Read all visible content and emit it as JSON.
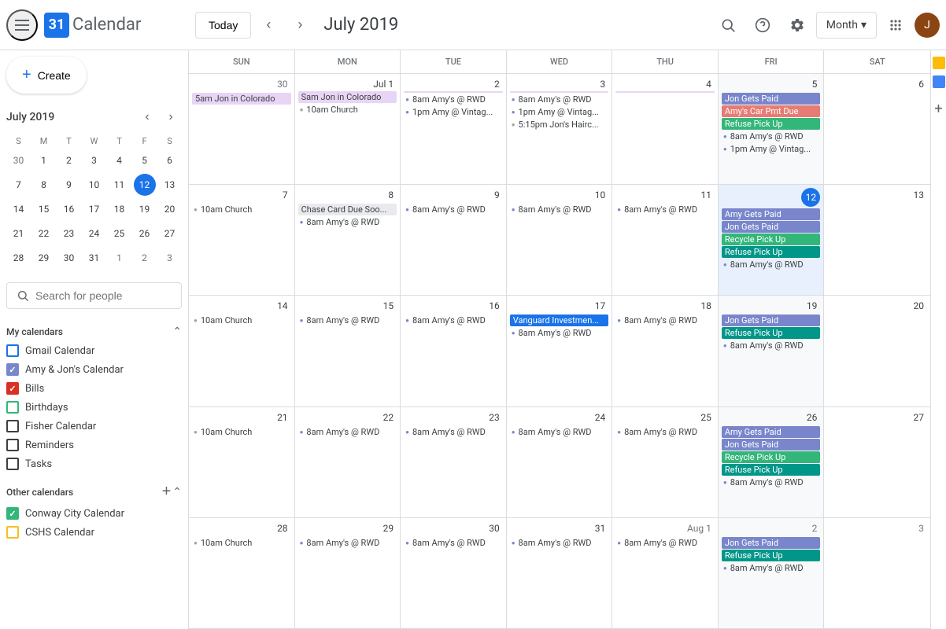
{
  "header": {
    "menu_label": "☰",
    "logo_number": "31",
    "app_title": "Calendar",
    "today_btn": "Today",
    "month_title": "July 2019",
    "view_label": "Month",
    "view_arrow": "▾"
  },
  "sidebar": {
    "create_label": "Create",
    "mini_cal": {
      "title": "July 2019",
      "day_labels": [
        "S",
        "M",
        "T",
        "W",
        "T",
        "F",
        "S"
      ],
      "weeks": [
        [
          {
            "d": "30",
            "other": true
          },
          {
            "d": "1"
          },
          {
            "d": "2"
          },
          {
            "d": "3"
          },
          {
            "d": "4"
          },
          {
            "d": "5"
          },
          {
            "d": "6"
          }
        ],
        [
          {
            "d": "7"
          },
          {
            "d": "8"
          },
          {
            "d": "9"
          },
          {
            "d": "10"
          },
          {
            "d": "11"
          },
          {
            "d": "12",
            "today": true
          },
          {
            "d": "13"
          }
        ],
        [
          {
            "d": "14"
          },
          {
            "d": "15"
          },
          {
            "d": "16"
          },
          {
            "d": "17"
          },
          {
            "d": "18"
          },
          {
            "d": "19"
          },
          {
            "d": "20"
          }
        ],
        [
          {
            "d": "21"
          },
          {
            "d": "22"
          },
          {
            "d": "23"
          },
          {
            "d": "24"
          },
          {
            "d": "25"
          },
          {
            "d": "26"
          },
          {
            "d": "27"
          }
        ],
        [
          {
            "d": "28"
          },
          {
            "d": "29"
          },
          {
            "d": "30"
          },
          {
            "d": "31"
          },
          {
            "d": "1",
            "other": true
          },
          {
            "d": "2",
            "other": true
          },
          {
            "d": "3",
            "other": true
          }
        ]
      ]
    },
    "search_people_placeholder": "Search for people",
    "my_calendars_title": "My calendars",
    "my_calendars": [
      {
        "label": "Gmail Calendar",
        "color": "#1a73e8",
        "checked": false
      },
      {
        "label": "Amy & Jon's Calendar",
        "color": "#7986cb",
        "checked": true
      },
      {
        "label": "Bills",
        "color": "#d93025",
        "checked": true
      },
      {
        "label": "Birthdays",
        "color": "#33b679",
        "checked": false
      },
      {
        "label": "Fisher Calendar",
        "color": "#3c4043",
        "checked": false
      },
      {
        "label": "Reminders",
        "color": "#3c4043",
        "checked": false
      },
      {
        "label": "Tasks",
        "color": "#3c4043",
        "checked": false
      }
    ],
    "other_calendars_title": "Other calendars",
    "other_calendars": [
      {
        "label": "Conway City Calendar",
        "color": "#33b679",
        "checked": true
      },
      {
        "label": "CSHS Calendar",
        "color": "#f6bf26",
        "checked": false
      }
    ]
  },
  "calendar": {
    "day_headers": [
      "SUN",
      "MON",
      "TUE",
      "WED",
      "THU",
      "FRI",
      "SAT"
    ],
    "weeks": [
      {
        "days": [
          {
            "date": "30",
            "other": true,
            "events": [
              {
                "type": "multiday",
                "label": "5am Jon in Colorado",
                "color": "lavender"
              }
            ]
          },
          {
            "date": "Jul 1",
            "events": [
              {
                "type": "gray-dot",
                "label": "10am Church"
              }
            ]
          },
          {
            "date": "2",
            "events": [
              {
                "type": "purple-dot",
                "label": "8am Amy's @ RWD"
              },
              {
                "type": "purple-dot",
                "label": "1pm Amy @ Vintag..."
              }
            ]
          },
          {
            "date": "3",
            "events": [
              {
                "type": "purple-dot",
                "label": "8am Amy's @ RWD"
              },
              {
                "type": "purple-dot",
                "label": "1pm Amy @ Vintag..."
              },
              {
                "type": "gray-dot",
                "label": "5:15pm Jon's Hairc..."
              }
            ]
          },
          {
            "date": "4",
            "events": []
          },
          {
            "date": "5",
            "fri": true,
            "events": [
              {
                "type": "purple-bg",
                "label": "Jon Gets Paid"
              },
              {
                "type": "pink-bg",
                "label": "Amy's Car Pmt Due"
              },
              {
                "type": "green-bg",
                "label": "Refuse Pick Up"
              },
              {
                "type": "purple-dot",
                "label": "8am Amy's @ RWD"
              },
              {
                "type": "purple-dot",
                "label": "1pm Amy @ Vintag..."
              }
            ]
          },
          {
            "date": "6",
            "events": []
          }
        ]
      },
      {
        "days": [
          {
            "date": "7",
            "events": [
              {
                "type": "gray-dot",
                "label": "10am Church"
              }
            ]
          },
          {
            "date": "8",
            "events": [
              {
                "type": "lavender-bg",
                "label": "Chase Card Due Soo..."
              },
              {
                "type": "purple-dot",
                "label": "8am Amy's @ RWD"
              }
            ]
          },
          {
            "date": "9",
            "events": [
              {
                "type": "purple-dot",
                "label": "8am Amy's @ RWD"
              }
            ]
          },
          {
            "date": "10",
            "events": [
              {
                "type": "purple-dot",
                "label": "8am Amy's @ RWD"
              }
            ]
          },
          {
            "date": "11",
            "events": [
              {
                "type": "purple-dot",
                "label": "8am Amy's @ RWD"
              }
            ]
          },
          {
            "date": "12",
            "today": true,
            "fri": true,
            "events": [
              {
                "type": "purple-bg",
                "label": "Amy Gets Paid"
              },
              {
                "type": "purple-bg",
                "label": "Jon Gets Paid"
              },
              {
                "type": "green-bg",
                "label": "Recycle Pick Up"
              },
              {
                "type": "teal-bg",
                "label": "Refuse Pick Up"
              },
              {
                "type": "purple-dot",
                "label": "8am Amy's @ RWD"
              }
            ]
          },
          {
            "date": "13",
            "events": []
          }
        ]
      },
      {
        "days": [
          {
            "date": "14",
            "events": [
              {
                "type": "gray-dot",
                "label": "10am Church"
              }
            ]
          },
          {
            "date": "15",
            "events": [
              {
                "type": "purple-dot",
                "label": "8am Amy's @ RWD"
              }
            ]
          },
          {
            "date": "16",
            "events": [
              {
                "type": "purple-dot",
                "label": "8am Amy's @ RWD"
              }
            ]
          },
          {
            "date": "17",
            "events": [
              {
                "type": "blue-bg",
                "label": "Vanguard Investmen..."
              },
              {
                "type": "purple-dot",
                "label": "8am Amy's @ RWD"
              }
            ]
          },
          {
            "date": "18",
            "events": [
              {
                "type": "purple-dot",
                "label": "8am Amy's @ RWD"
              }
            ]
          },
          {
            "date": "19",
            "fri": true,
            "events": [
              {
                "type": "purple-bg",
                "label": "Jon Gets Paid"
              },
              {
                "type": "teal-bg",
                "label": "Refuse Pick Up"
              },
              {
                "type": "purple-dot",
                "label": "8am Amy's @ RWD"
              }
            ]
          },
          {
            "date": "20",
            "events": []
          }
        ]
      },
      {
        "days": [
          {
            "date": "21",
            "events": [
              {
                "type": "gray-dot",
                "label": "10am Church"
              }
            ]
          },
          {
            "date": "22",
            "events": [
              {
                "type": "purple-dot",
                "label": "8am Amy's @ RWD"
              }
            ]
          },
          {
            "date": "23",
            "events": [
              {
                "type": "purple-dot",
                "label": "8am Amy's @ RWD"
              }
            ]
          },
          {
            "date": "24",
            "events": [
              {
                "type": "purple-dot",
                "label": "8am Amy's @ RWD"
              }
            ]
          },
          {
            "date": "25",
            "events": [
              {
                "type": "purple-dot",
                "label": "8am Amy's @ RWD"
              }
            ]
          },
          {
            "date": "26",
            "fri": true,
            "events": [
              {
                "type": "purple-bg",
                "label": "Amy Gets Paid"
              },
              {
                "type": "purple-bg",
                "label": "Jon Gets Paid"
              },
              {
                "type": "green-bg",
                "label": "Recycle Pick Up"
              },
              {
                "type": "teal-bg",
                "label": "Refuse Pick Up"
              },
              {
                "type": "purple-dot",
                "label": "8am Amy's @ RWD"
              }
            ]
          },
          {
            "date": "27",
            "events": []
          }
        ]
      },
      {
        "days": [
          {
            "date": "28",
            "events": [
              {
                "type": "gray-dot",
                "label": "10am Church"
              }
            ]
          },
          {
            "date": "29",
            "events": [
              {
                "type": "purple-dot",
                "label": "8am Amy's @ RWD"
              }
            ]
          },
          {
            "date": "30",
            "events": [
              {
                "type": "purple-dot",
                "label": "8am Amy's @ RWD"
              }
            ]
          },
          {
            "date": "31",
            "events": [
              {
                "type": "purple-dot",
                "label": "8am Amy's @ RWD"
              }
            ]
          },
          {
            "date": "Aug 1",
            "other": true,
            "events": [
              {
                "type": "purple-dot",
                "label": "8am Amy's @ RWD"
              }
            ]
          },
          {
            "date": "2",
            "other": true,
            "fri": true,
            "events": [
              {
                "type": "purple-bg",
                "label": "Jon Gets Paid"
              },
              {
                "type": "teal-bg",
                "label": "Refuse Pick Up"
              },
              {
                "type": "purple-dot",
                "label": "8am Amy's @ RWD"
              }
            ]
          },
          {
            "date": "3",
            "other": true,
            "events": []
          }
        ]
      }
    ]
  }
}
